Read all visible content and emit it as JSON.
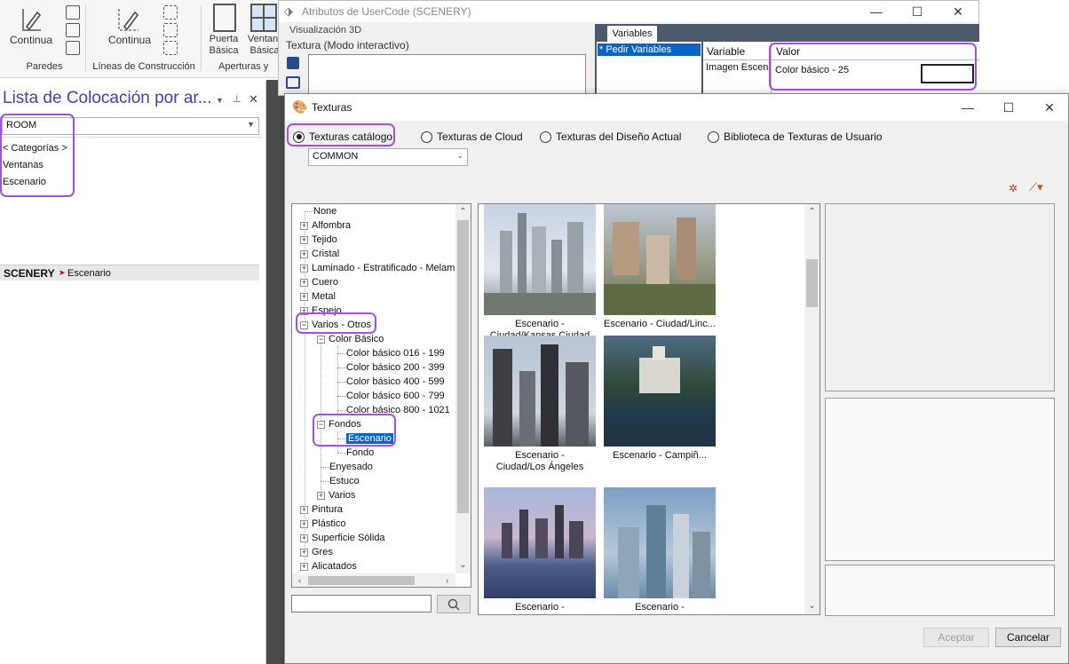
{
  "ribbon": {
    "continua1_label": "Continua",
    "paredes_label": "Paredes",
    "continua2_label": "Continua",
    "lineas_label": "Líneas de Construcción",
    "puerta_label": "Puerta",
    "basica_label": "Básica",
    "ventana_label": "Ventan",
    "basica2_label": "Básica",
    "aperturas_label": "Aperturas y"
  },
  "left_panel": {
    "title": "Lista de Colocación por ar...",
    "combo_value": "ROOM",
    "items": [
      "< Categorías >",
      "Ventanas",
      "Escenario"
    ],
    "scenery_key": "SCENERY",
    "scenery_value": "Escenario"
  },
  "usercode": {
    "title": "Atributos de UserCode (SCENERY)",
    "tab_3d": "Visualización 3D",
    "texture_label": "Textura (Modo interactivo)",
    "variables_tab": "Variables",
    "pedir_variables": "* Pedir Variables",
    "col_variable": "Variable",
    "col_valor": "Valor",
    "row_variable": "Imagen Escen",
    "row_valor": "Color básico - 25"
  },
  "texturas": {
    "title": "Texturas",
    "radios": [
      {
        "label": "Texturas catálogo",
        "checked": true
      },
      {
        "label": "Texturas de Cloud",
        "checked": false
      },
      {
        "label": "Texturas del Diseño Actual",
        "checked": false
      },
      {
        "label": "Biblioteca de Texturas de Usuario",
        "checked": false
      }
    ],
    "catalog_value": "COMMON",
    "tree": [
      "None",
      "Alfombra",
      "Tejido",
      "Cristal",
      "Laminado - Estratificado - Melamin",
      "Cuero",
      "Metal",
      "Espejo",
      "Varios - Otros",
      "Color Básico",
      "Color básico 016 - 199",
      "Color básico 200 - 399",
      "Color básico 400 - 599",
      "Color básico 600 - 799",
      "Color básico 800 - 1021",
      "Fondos",
      "Escenario",
      "Fondo",
      "Enyesado",
      "Estuco",
      "Varios",
      "Pintura",
      "Plástico",
      "Superficie Sólida",
      "Gres",
      "Alicatados"
    ],
    "thumbs": [
      {
        "line1": "Escenario -",
        "line2": "Ciudad/Kansas Ciudad"
      },
      {
        "line1": "Escenario - Ciudad/Linc...",
        "line2": ""
      },
      {
        "line1": "Escenario -",
        "line2": "Ciudad/Los Ángeles"
      },
      {
        "line1": "Escenario - Campiñ...",
        "line2": ""
      },
      {
        "line1": "Escenario -",
        "line2": ""
      },
      {
        "line1": "Escenario -",
        "line2": ""
      }
    ],
    "aceptar": "Aceptar",
    "cancelar": "Cancelar"
  },
  "colors": {
    "highlight": "#a450e8",
    "selection": "#0a64c8",
    "panel_title": "#4a3ab8"
  }
}
